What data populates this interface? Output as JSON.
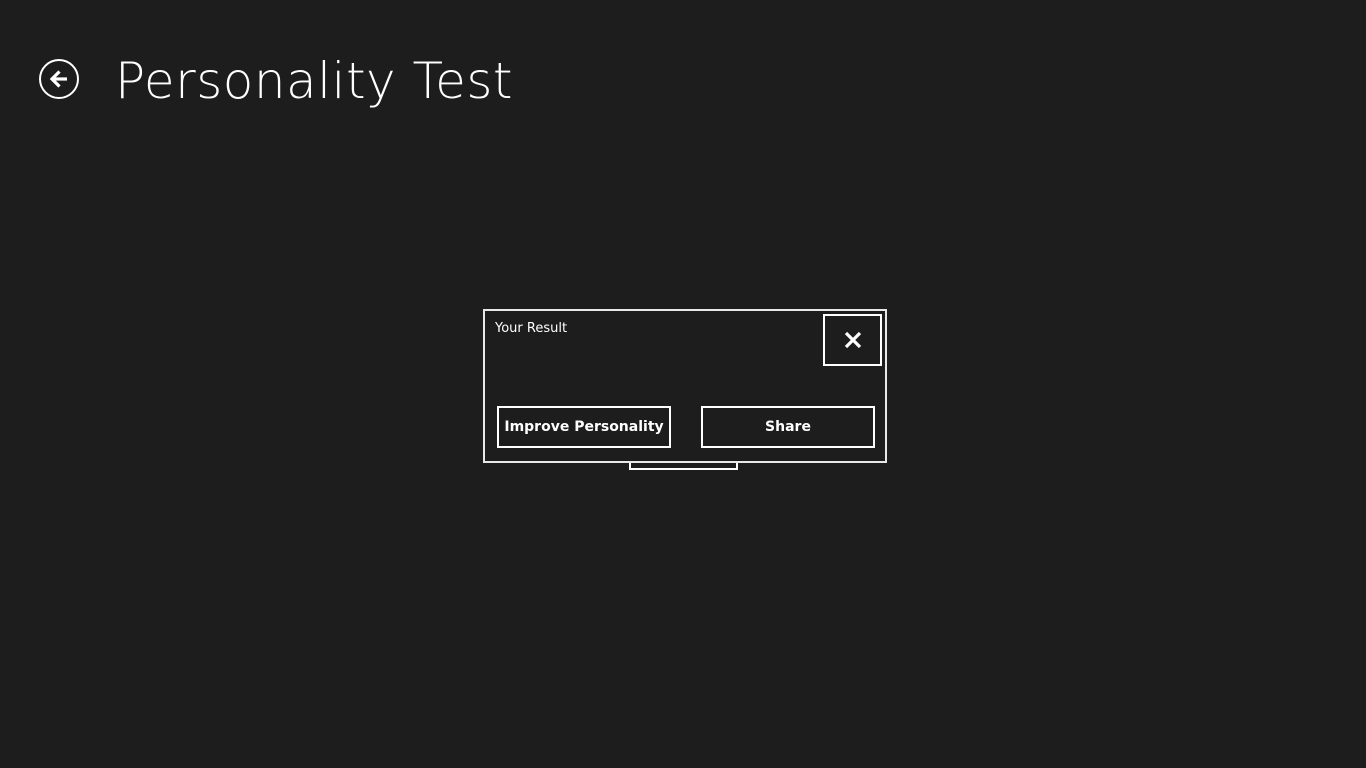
{
  "header": {
    "title": "Personality Test",
    "back_icon": "back-arrow-icon"
  },
  "dialog": {
    "title": "Your Result",
    "close_icon": "close-icon",
    "buttons": {
      "improve_label": "Improve Personality",
      "share_label": "Share"
    }
  },
  "colors": {
    "background": "#1d1d1d",
    "foreground": "#ffffff",
    "dialog_border": "#e8e8e8"
  }
}
